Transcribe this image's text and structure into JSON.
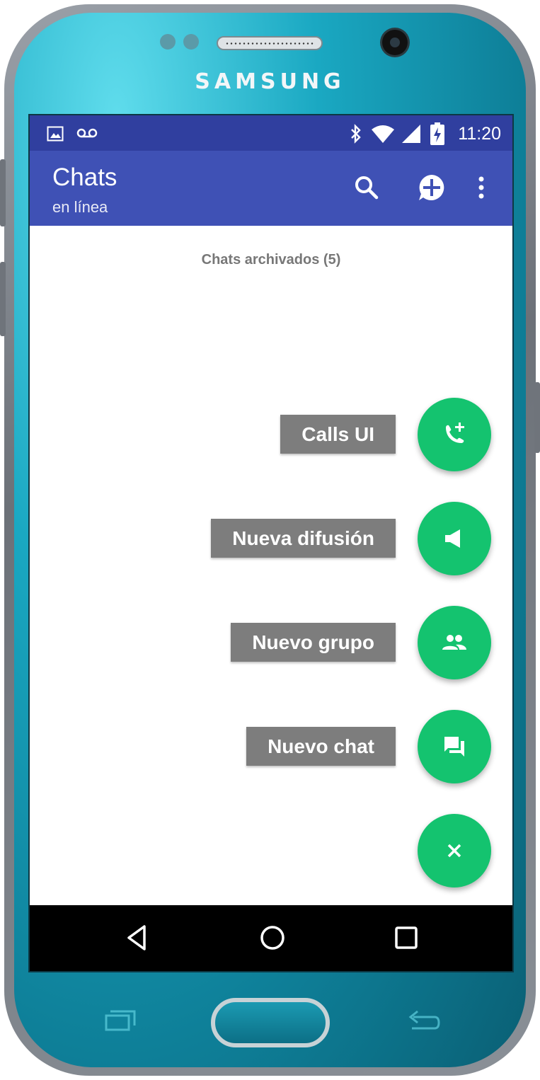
{
  "device": {
    "brand": "SAMSUNG"
  },
  "status_bar": {
    "time": "11:20"
  },
  "app_bar": {
    "title": "Chats",
    "subtitle": "en línea"
  },
  "content": {
    "archived_label": "Chats archivados (5)"
  },
  "fab_menu": [
    {
      "label": "Calls UI",
      "icon": "add-call-icon"
    },
    {
      "label": "Nueva difusión",
      "icon": "megaphone-icon"
    },
    {
      "label": "Nuevo grupo",
      "icon": "group-icon"
    },
    {
      "label": "Nuevo chat",
      "icon": "chat-icon"
    }
  ],
  "fab_main": {
    "icon": "close-icon"
  },
  "colors": {
    "primary": "#3f51b5",
    "primary_dark": "#303f9f",
    "accent": "#14c36f",
    "label_bg": "#7d7d7d"
  }
}
